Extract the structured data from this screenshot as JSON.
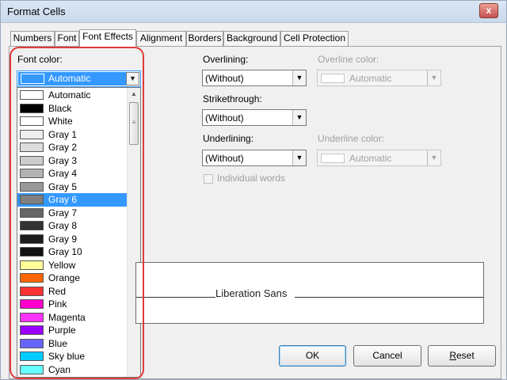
{
  "window": {
    "title": "Format Cells",
    "close_glyph": "x"
  },
  "tabs": [
    {
      "label": "Numbers"
    },
    {
      "label": "Font"
    },
    {
      "label": "Font Effects"
    },
    {
      "label": "Alignment"
    },
    {
      "label": "Borders"
    },
    {
      "label": "Background"
    },
    {
      "label": "Cell Protection"
    }
  ],
  "font_color": {
    "label": "Font color:",
    "selected": "Automatic",
    "options": [
      {
        "name": "Automatic",
        "color": "#ffffff"
      },
      {
        "name": "Black",
        "color": "#000000"
      },
      {
        "name": "White",
        "color": "#ffffff"
      },
      {
        "name": "Gray 1",
        "color": "#eeeeee"
      },
      {
        "name": "Gray 2",
        "color": "#dddddd"
      },
      {
        "name": "Gray 3",
        "color": "#cccccc"
      },
      {
        "name": "Gray 4",
        "color": "#b2b2b2"
      },
      {
        "name": "Gray 5",
        "color": "#999999"
      },
      {
        "name": "Gray 6",
        "color": "#808080"
      },
      {
        "name": "Gray 7",
        "color": "#666666"
      },
      {
        "name": "Gray 8",
        "color": "#333333"
      },
      {
        "name": "Gray 9",
        "color": "#1c1c1c"
      },
      {
        "name": "Gray 10",
        "color": "#111111"
      },
      {
        "name": "Yellow",
        "color": "#ffff99"
      },
      {
        "name": "Orange",
        "color": "#ff6600"
      },
      {
        "name": "Red",
        "color": "#ff3333"
      },
      {
        "name": "Pink",
        "color": "#ff00cc"
      },
      {
        "name": "Magenta",
        "color": "#ff33ff"
      },
      {
        "name": "Purple",
        "color": "#9900ff"
      },
      {
        "name": "Blue",
        "color": "#6666ff"
      },
      {
        "name": "Sky blue",
        "color": "#00ccff"
      },
      {
        "name": "Cyan",
        "color": "#66ffff"
      }
    ],
    "highlighted": "Gray 6"
  },
  "overlining": {
    "label": "Overlining:",
    "value": "(Without)"
  },
  "overline_color": {
    "label": "Overline color:",
    "value": "Automatic"
  },
  "strikethrough": {
    "label": "Strikethrough:",
    "value": "(Without)"
  },
  "underlining": {
    "label": "Underlining:",
    "value": "(Without)"
  },
  "underline_color": {
    "label": "Underline color:",
    "value": "Automatic"
  },
  "individual_words": {
    "label": "Individual words"
  },
  "preview": {
    "text": "Liberation Sans"
  },
  "buttons": {
    "ok": "OK",
    "cancel": "Cancel",
    "reset": "Reset"
  },
  "colors": {
    "selection": "#3399ff",
    "annotation_ring": "#e03a3a"
  }
}
